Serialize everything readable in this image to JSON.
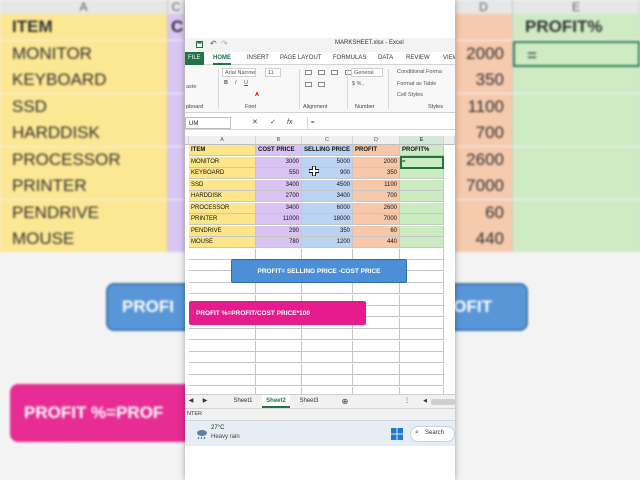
{
  "background": {
    "col_headers": [
      "A",
      "C",
      "D",
      "E"
    ],
    "rows": [
      {
        "item": "ITEM",
        "c": "CO",
        "d": "",
        "e": "PROFIT%",
        "header": true
      },
      {
        "item": "MONITOR",
        "c": "",
        "d": "2000",
        "e": "="
      },
      {
        "item": "KEYBOARD",
        "c": "",
        "d": "350",
        "e": ""
      },
      {
        "item": "SSD",
        "c": "",
        "d": "1100",
        "e": ""
      },
      {
        "item": "HARDDISK",
        "c": "",
        "d": "700",
        "e": ""
      },
      {
        "item": "PROCESSOR",
        "c": "",
        "d": "2600",
        "e": ""
      },
      {
        "item": "PRINTER",
        "c": "",
        "d": "7000",
        "e": ""
      },
      {
        "item": "PENDRIVE",
        "c": "",
        "d": "60",
        "e": ""
      },
      {
        "item": "MOUSE",
        "c": "",
        "d": "440",
        "e": ""
      }
    ],
    "box_profit": "PROFI",
    "box_profit_right": "PROFIT",
    "box_percent": "PROFIT %=PROF",
    "colors": {
      "item": "#fde68a",
      "cost": "#d8c3f3",
      "profit_col": "#f6c7a8",
      "pct_col": "#cbebc1",
      "blue_box": "#4c8fd6",
      "pink_box": "#e61c8c"
    }
  },
  "window": {
    "title": "MARKSHEET.xlsx - Excel",
    "tabs": [
      "FILE",
      "HOME",
      "INSERT",
      "PAGE LAYOUT",
      "FORMULAS",
      "DATA",
      "REVIEW",
      "VIEW"
    ],
    "active_tab": "HOME",
    "ribbon": {
      "font_name": "Arial Narrow",
      "font_size": "11",
      "number_format": "General",
      "conditional": "Conditional Forma",
      "format_table": "Format as Table",
      "cell_styles": "Cell Styles",
      "groups": [
        "pboard",
        "Font",
        "Alignment",
        "Number",
        "Styles"
      ]
    },
    "name_box": "UM",
    "formula_bar_value": "=",
    "formula_bar_icons": [
      "✕",
      "✓",
      "fx"
    ]
  },
  "sheet": {
    "col_headers": [
      "A",
      "B",
      "C",
      "D",
      "E"
    ],
    "headers": [
      "ITEM",
      "COST PRICE",
      "SELLING PRICE",
      "PROFIT",
      "PROFIT%"
    ],
    "rows": [
      {
        "item": "MONITOR",
        "cost": "3000",
        "sell": "5000",
        "profit": "2000",
        "pct": "="
      },
      {
        "item": "KEYBOARD",
        "cost": "550",
        "sell": "900",
        "profit": "350",
        "pct": ""
      },
      {
        "item": "SSD",
        "cost": "3400",
        "sell": "4500",
        "profit": "1100",
        "pct": ""
      },
      {
        "item": "HARDDISK",
        "cost": "2700",
        "sell": "3400",
        "profit": "700",
        "pct": ""
      },
      {
        "item": "PROCESSOR",
        "cost": "3400",
        "sell": "6000",
        "profit": "2600",
        "pct": ""
      },
      {
        "item": "PRINTER",
        "cost": "11000",
        "sell": "18000",
        "profit": "7000",
        "pct": ""
      },
      {
        "item": "PENDRIVE",
        "cost": "290",
        "sell": "350",
        "profit": "60",
        "pct": ""
      },
      {
        "item": "MOUSE",
        "cost": "780",
        "sell": "1200",
        "profit": "440",
        "pct": ""
      }
    ],
    "formula_profit": "PROFIT= SELLING PRICE -COST PRICE",
    "formula_percent": "PROFIT %=PROFIT/COST PRICE*100",
    "colors": {
      "item": "#fde68a",
      "cost": "#d8c3f3",
      "sell": "#bcd4f3",
      "profit": "#f6c7a8",
      "pct": "#cbebc1",
      "blue_box": "#4c8fd6",
      "pink_box": "#e61c8c",
      "excel_green": "#217346"
    }
  },
  "sheet_tabs": [
    "Sheet1",
    "Sheet2",
    "Sheet3"
  ],
  "active_sheet": "Sheet2",
  "status_mode": "NTER",
  "weather": {
    "temp": "27°C",
    "desc": "Heavy rain"
  },
  "taskbar_search": "Search"
}
